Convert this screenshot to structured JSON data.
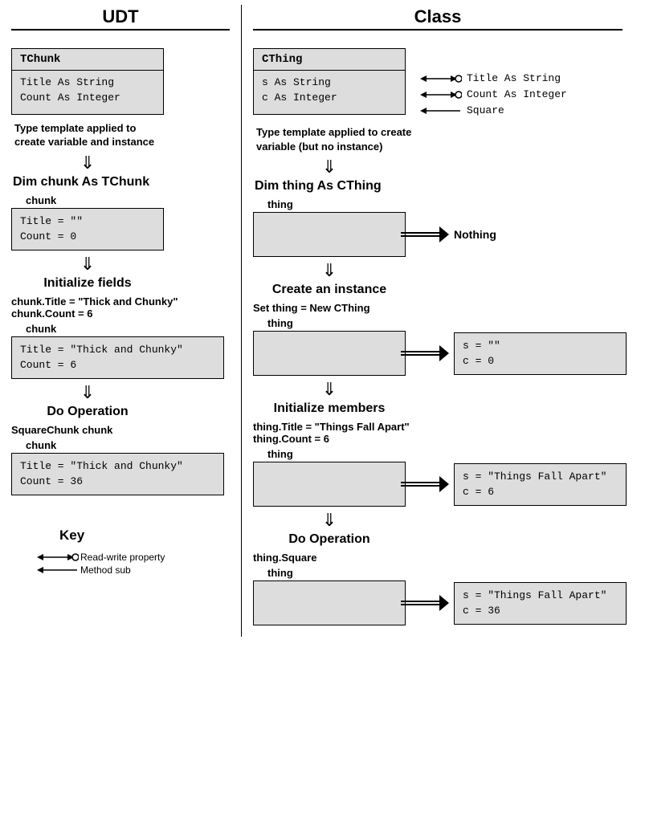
{
  "left": {
    "title": "UDT",
    "type_name": "TChunk",
    "type_members": "Title As String\nCount As Integer",
    "tmpl_caption": "Type template applied to create variable and instance",
    "dim_stmt": "Dim chunk As TChunk",
    "var_label": "chunk",
    "init_box": "Title = \"\"\nCount = 0",
    "step2_title": "Initialize fields",
    "step2_code": "chunk.Title = \"Thick and Chunky\"\nchunk.Count = 6",
    "step2_box": "Title = \"Thick and Chunky\"\nCount = 6",
    "step3_title": "Do Operation",
    "step3_code": "SquareChunk chunk",
    "step3_box": "Title = \"Thick and Chunky\"\nCount = 36"
  },
  "right": {
    "title": "Class",
    "type_name": "CThing",
    "type_members": "s As String\nc As Integer",
    "anno1": "Title As String",
    "anno2": "Count As Integer",
    "anno3": "Square",
    "tmpl_caption": "Type template applied to create variable (but no instance)",
    "dim_stmt": "Dim thing As CThing",
    "var_label": "thing",
    "nothing_label": "Nothing",
    "step2_title": "Create an instance",
    "step2_code": "Set thing = New CThing",
    "inst2": "s = \"\"\nc = 0",
    "step3_title": "Initialize members",
    "step3_code": "thing.Title = \"Things Fall Apart\"\nthing.Count = 6",
    "inst3": "s = \"Things Fall Apart\"\nc = 6",
    "step4_title": "Do Operation",
    "step4_code": "thing.Square",
    "inst4": "s = \"Things Fall Apart\"\nc = 36"
  },
  "key": {
    "title": "Key",
    "rw": "Read-write property",
    "ms": "Method sub"
  }
}
